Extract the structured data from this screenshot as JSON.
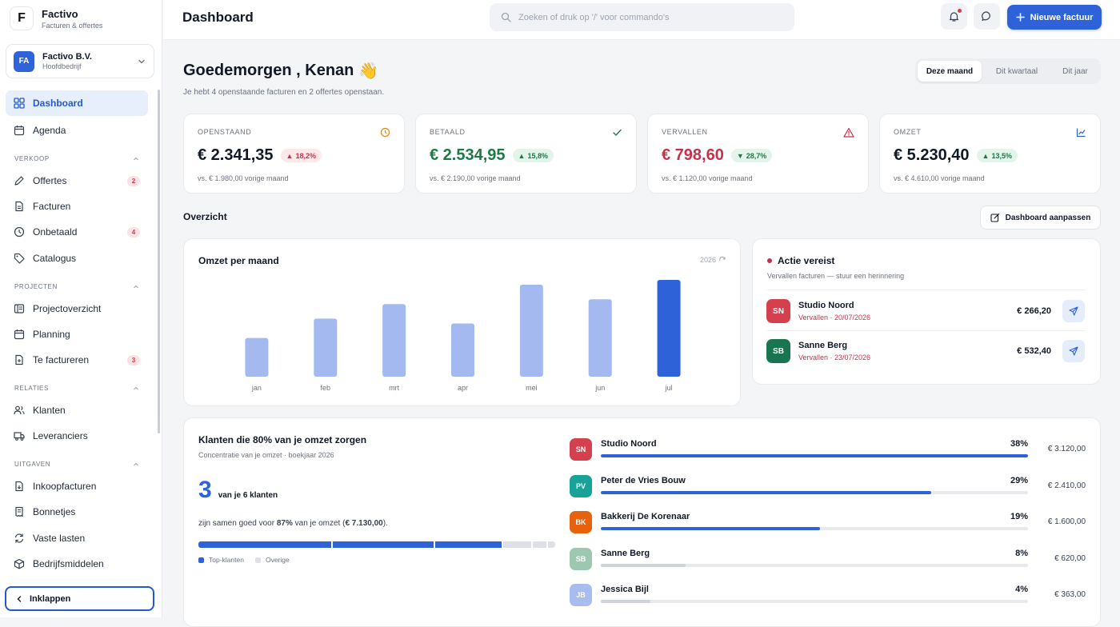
{
  "brand": {
    "logo_letter": "F",
    "name": "Factivo",
    "subtitle": "Facturen & offertes"
  },
  "company": {
    "initials": "FA",
    "name": "Factivo B.V.",
    "role": "Hoofdbedrijf"
  },
  "nav": {
    "dashboard": "Dashboard",
    "agenda": "Agenda",
    "sections": {
      "verkoop": "VERKOOP",
      "projecten": "PROJECTEN",
      "relaties": "RELATIES",
      "uitgaven": "UITGAVEN"
    },
    "offertes": {
      "label": "Offertes",
      "badge": "2"
    },
    "facturen": "Facturen",
    "onbetaald": {
      "label": "Onbetaald",
      "badge": "4"
    },
    "catalogus": "Catalogus",
    "projectoverzicht": "Projectoverzicht",
    "planning": "Planning",
    "te_factureren": {
      "label": "Te factureren",
      "badge": "3"
    },
    "klanten": "Klanten",
    "leveranciers": "Leveranciers",
    "inkoopfacturen": "Inkoopfacturen",
    "bonnetjes": "Bonnetjes",
    "vaste_lasten": "Vaste lasten",
    "bedrijfsmiddelen": "Bedrijfsmiddelen",
    "collapse": "Inklappen"
  },
  "topbar": {
    "title": "Dashboard",
    "search_placeholder": "Zoeken of druk op '/' voor commando's",
    "new_invoice": "Nieuwe factuur"
  },
  "greeting": {
    "text": "Goedemorgen , Kenan",
    "emoji": "👋",
    "subtitle": "Je hebt 4 openstaande facturen en 2 offertes openstaan."
  },
  "period": {
    "options": [
      "Deze maand",
      "Dit kwartaal",
      "Dit jaar"
    ],
    "selected": "Deze maand"
  },
  "kpis": [
    {
      "label": "OPENSTAAND",
      "value": "€ 2.341,35",
      "change": "18,2%",
      "direction": "up",
      "tone": "red",
      "previous": "vs. € 1.980,00 vorige maand",
      "icon": "clock-icon",
      "color": "#d98a1c"
    },
    {
      "label": "BETAALD",
      "value": "€ 2.534,95",
      "change": "15,8%",
      "direction": "up",
      "tone": "green",
      "previous": "vs. € 2.190,00 vorige maand",
      "icon": "check-icon",
      "color": "#1c7a45"
    },
    {
      "label": "VERVALLEN",
      "value": "€ 798,60",
      "change": "28,7%",
      "direction": "down",
      "tone": "green",
      "previous": "vs. € 1.120,00 vorige maand",
      "icon": "warning-icon",
      "color": "#c8304a"
    },
    {
      "label": "OMZET",
      "value": "€ 5.230,40",
      "change": "13,5%",
      "direction": "up",
      "tone": "green",
      "previous": "vs. € 4.610,00 vorige maand",
      "icon": "chart-line-icon",
      "color": "#2e62d8"
    }
  ],
  "overview": {
    "title": "Overzicht",
    "customize": "Dashboard aanpassen"
  },
  "revenue_chart": {
    "title": "Omzet per maand",
    "year": "2026"
  },
  "chart_data": {
    "type": "bar",
    "title": "Omzet per maand",
    "categories": [
      "jan",
      "feb",
      "mrt",
      "apr",
      "mei",
      "jun",
      "jul"
    ],
    "values": [
      40,
      60,
      75,
      55,
      95,
      80,
      100
    ],
    "highlight_index": 6,
    "colors": {
      "bar": "#a3b9f0",
      "highlight": "#2e62d8"
    },
    "ylim": [
      0,
      100
    ],
    "grid": false
  },
  "action": {
    "title": "Actie vereist",
    "subtitle": "Vervallen facturen — stuur een herinnering",
    "items": [
      {
        "initials": "SN",
        "name": "Studio Noord",
        "status": "Vervallen · 20/07/2026",
        "amount": "€ 266,20",
        "color": "#d5404f"
      },
      {
        "initials": "SB",
        "name": "Sanne Berg",
        "status": "Vervallen · 23/07/2026",
        "amount": "€ 532,40",
        "color": "#187550"
      }
    ]
  },
  "concentration": {
    "title": "Klanten die 80% van je omzet zorgen",
    "subtitle": "Concentratie van je omzet · boekjaar 2026",
    "count": "3",
    "count_suffix": "van je 6 klanten",
    "sentence_pre": "zijn samen goed voor",
    "pct": "87%",
    "sentence_mid": "van je omzet (",
    "amount": "€ 7.130,00",
    "sentence_post": ").",
    "segments": [
      38,
      29,
      19,
      8,
      4,
      2
    ],
    "legend_top": "Top-klanten",
    "legend_other": "Overige",
    "clients": [
      {
        "initials": "SN",
        "name": "Studio Noord",
        "pct": "38%",
        "share": 1.0,
        "amount": "€ 3.120,00",
        "color": "#d5404f",
        "bar": "#2e62d8"
      },
      {
        "initials": "PV",
        "name": "Peter de Vries Bouw",
        "pct": "29%",
        "share": 0.774,
        "amount": "€ 2.410,00",
        "color": "#17a398",
        "bar": "#2e62d8"
      },
      {
        "initials": "BK",
        "name": "Bakkerij De Korenaar",
        "pct": "19%",
        "share": 0.513,
        "amount": "€ 1.600,00",
        "color": "#e8610e",
        "bar": "#2e62d8"
      },
      {
        "initials": "SB",
        "name": "Sanne Berg",
        "pct": "8%",
        "share": 0.199,
        "amount": "€ 620,00",
        "color": "#9cc8b1",
        "bar": "#cfd4dc"
      },
      {
        "initials": "JB",
        "name": "Jessica Bijl",
        "pct": "4%",
        "share": 0.116,
        "amount": "€ 363,00",
        "color": "#a9bcf0",
        "bar": "#cfd4dc"
      }
    ]
  }
}
